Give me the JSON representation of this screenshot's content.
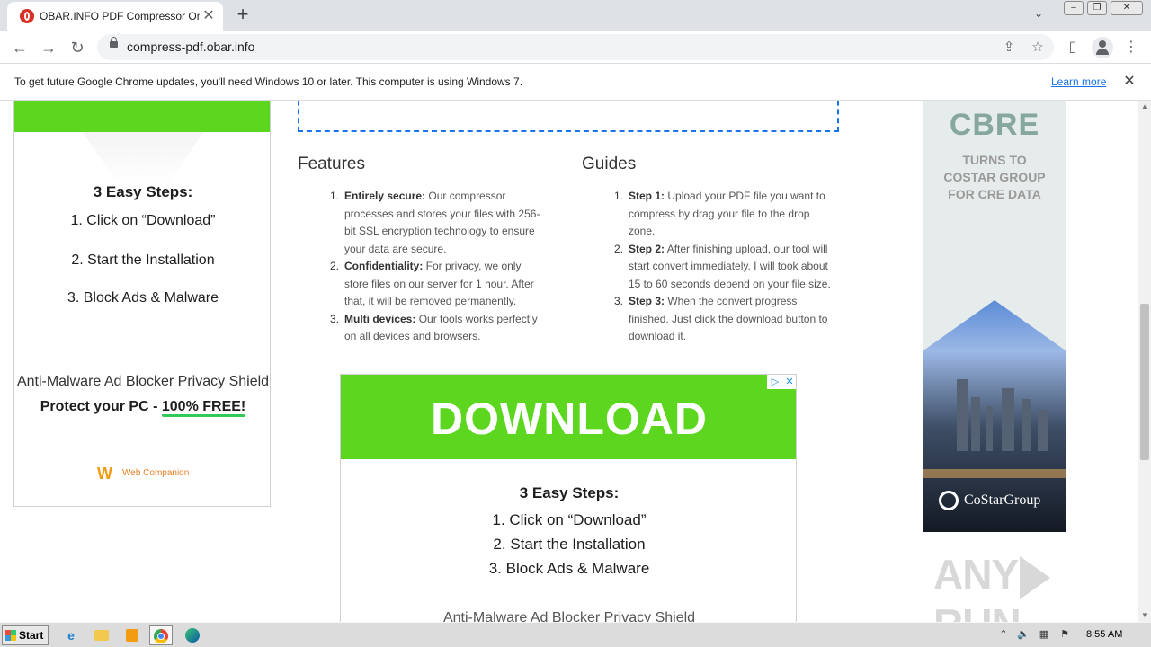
{
  "browser": {
    "tab": {
      "title": "OBAR.INFO PDF Compressor Online",
      "close": "✕"
    },
    "new_tab": "+",
    "url": "compress-pdf.obar.info",
    "infobar": {
      "message": "To get future Google Chrome updates, you'll need Windows 10 or later. This computer is using Windows 7.",
      "link": "Learn more",
      "close": "✕"
    }
  },
  "ad_left": {
    "steps_title": "3 Easy Steps:",
    "steps": [
      "1. Click on “Download”",
      "2. Start the Installation",
      "3. Block Ads & Malware"
    ],
    "subtitle": "Anti-Malware Ad Blocker Privacy Shield",
    "protect_prefix": "Protect your PC - ",
    "protect_highlight": "100% FREE!",
    "brand": "Web Companion"
  },
  "features": {
    "title": "Features",
    "items": [
      {
        "num": "1.",
        "label": "Entirely secure:",
        "text": " Our compressor processes and stores your files with 256-bit SSL encryption technology to ensure your data are secure."
      },
      {
        "num": "2.",
        "label": "Confidentiality:",
        "text": " For privacy, we only store files on our server for 1 hour. After that, it will be removed permanently."
      },
      {
        "num": "3.",
        "label": "Multi devices:",
        "text": " Our tools works perfectly on all devices and browsers."
      }
    ]
  },
  "guides": {
    "title": "Guides",
    "items": [
      {
        "num": "1.",
        "label": "Step 1:",
        "text": " Upload your PDF file you want to compress by drag your file to the drop zone."
      },
      {
        "num": "2.",
        "label": "Step 2:",
        "text": " After finishing upload, our tool will start convert immediately. I will took about 15 to 60 seconds depend on your file size."
      },
      {
        "num": "3.",
        "label": "Step 3:",
        "text": " When the convert progress finished. Just click the download button to download it."
      }
    ]
  },
  "ad_download": {
    "title": "DOWNLOAD",
    "steps_title": "3 Easy Steps:",
    "steps": [
      "1. Click on “Download”",
      "2. Start the Installation",
      "3. Block Ads & Malware"
    ],
    "subtitle": "Anti-Malware Ad Blocker Privacy Shield"
  },
  "ad_right": {
    "brand": "CBRE",
    "lines": [
      "TURNS TO",
      "COSTAR GROUP",
      "FOR CRE DATA"
    ],
    "sponsor": "CoStarGroup"
  },
  "watermark": {
    "left": "ANY",
    "right": "RUN"
  },
  "taskbar": {
    "start": "Start",
    "time": "8:55 AM"
  },
  "colors": {
    "ad_green": "#5dd61f",
    "link_blue": "#1a73e8",
    "dropzone_border": "#1a73e8"
  }
}
